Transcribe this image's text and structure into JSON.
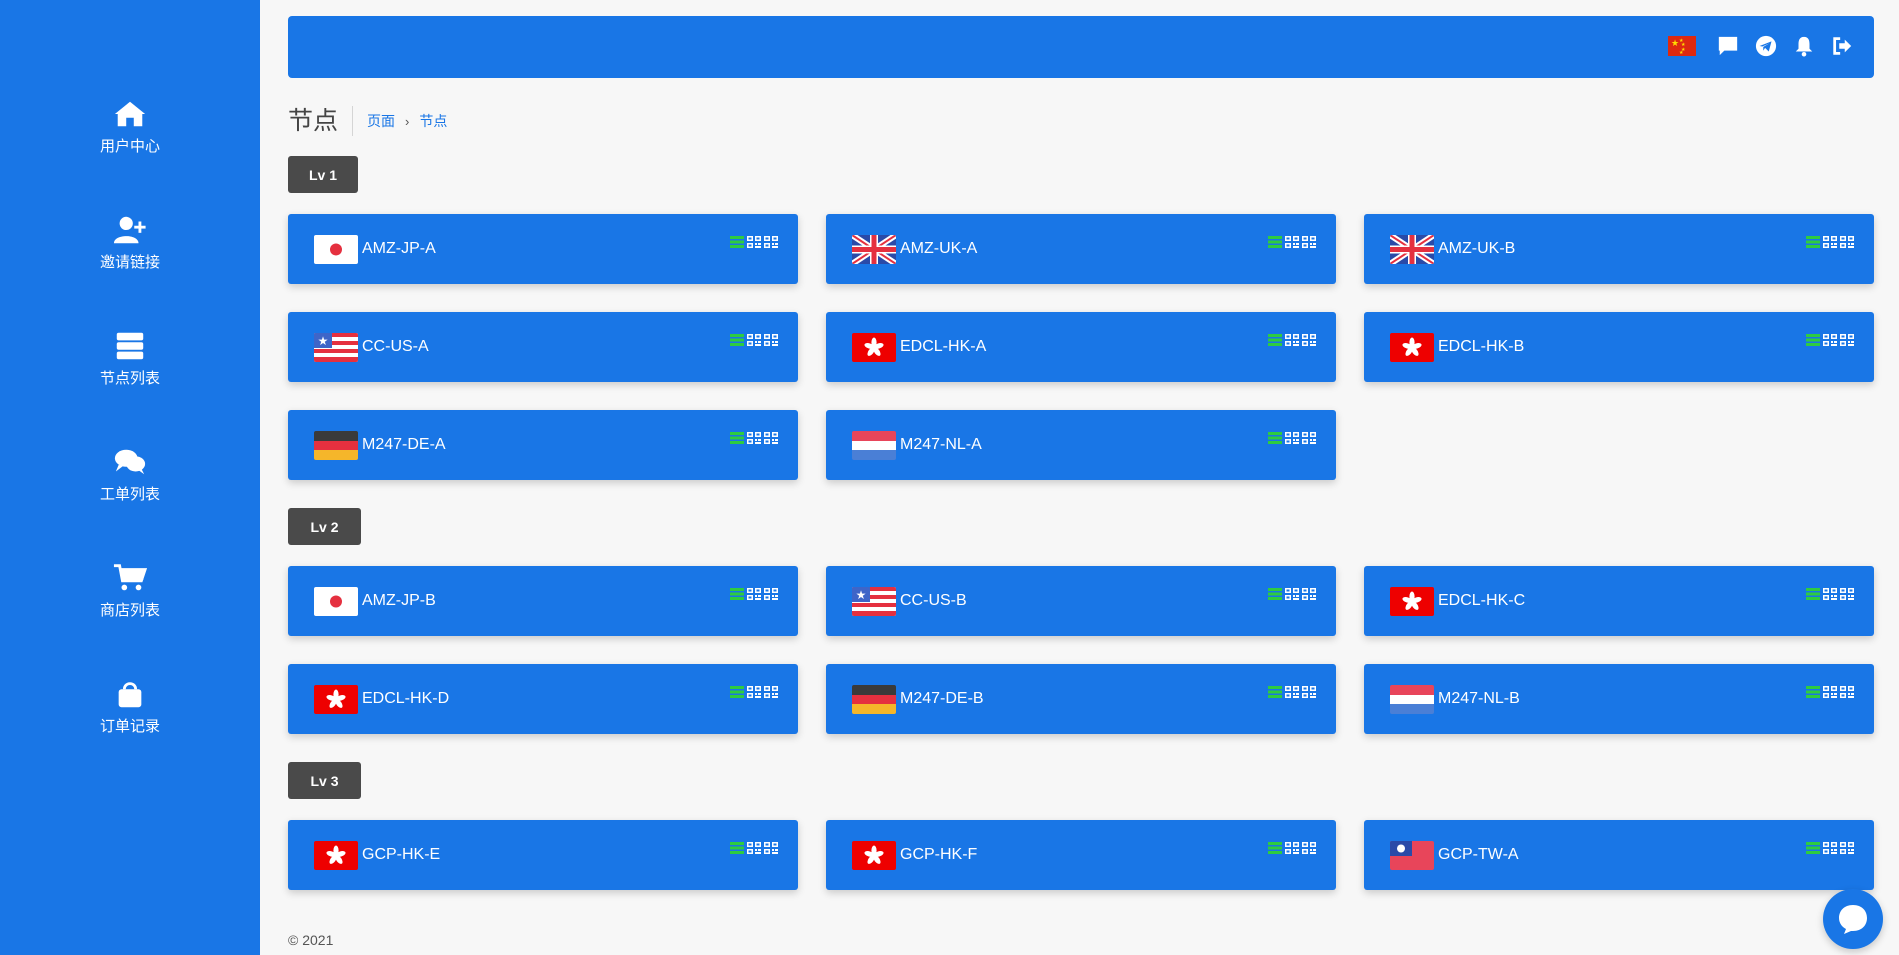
{
  "sidebar": {
    "items": [
      {
        "label": "用户中心",
        "icon": "home-icon"
      },
      {
        "label": "邀请链接",
        "icon": "user-plus-icon"
      },
      {
        "label": "节点列表",
        "icon": "server-icon"
      },
      {
        "label": "工单列表",
        "icon": "comments-icon"
      },
      {
        "label": "商店列表",
        "icon": "cart-icon"
      },
      {
        "label": "订单记录",
        "icon": "shopping-bag-icon"
      }
    ]
  },
  "topbar": {
    "icons": [
      "china-flag-icon",
      "message-icon",
      "telegram-icon",
      "bell-icon",
      "logout-icon"
    ]
  },
  "page": {
    "title": "节点",
    "breadcrumb": {
      "parent": "页面",
      "separator": "›",
      "current": "节点"
    }
  },
  "levels": [
    {
      "label": "Lv 1",
      "nodes": [
        {
          "name": "AMZ-JP-A",
          "flag": "jp"
        },
        {
          "name": "AMZ-UK-A",
          "flag": "uk"
        },
        {
          "name": "AMZ-UK-B",
          "flag": "uk"
        },
        {
          "name": "CC-US-A",
          "flag": "us"
        },
        {
          "name": "EDCL-HK-A",
          "flag": "hk"
        },
        {
          "name": "EDCL-HK-B",
          "flag": "hk"
        },
        {
          "name": "M247-DE-A",
          "flag": "de"
        },
        {
          "name": "M247-NL-A",
          "flag": "nl"
        }
      ]
    },
    {
      "label": "Lv 2",
      "nodes": [
        {
          "name": "AMZ-JP-B",
          "flag": "jp"
        },
        {
          "name": "CC-US-B",
          "flag": "us"
        },
        {
          "name": "EDCL-HK-C",
          "flag": "hk"
        },
        {
          "name": "EDCL-HK-D",
          "flag": "hk"
        },
        {
          "name": "M247-DE-B",
          "flag": "de"
        },
        {
          "name": "M247-NL-B",
          "flag": "nl"
        }
      ]
    },
    {
      "label": "Lv 3",
      "nodes": [
        {
          "name": "GCP-HK-E",
          "flag": "hk"
        },
        {
          "name": "GCP-HK-F",
          "flag": "hk"
        },
        {
          "name": "GCP-TW-A",
          "flag": "tw"
        }
      ]
    }
  ],
  "node_actions": [
    "list-icon",
    "qrcode-icon",
    "qrcode-icon"
  ],
  "colors": {
    "brand": "#1976e6",
    "badge": "#4a4a4a",
    "action_green": "#2ecc40"
  },
  "footer": {
    "copyright": "© 2021"
  }
}
